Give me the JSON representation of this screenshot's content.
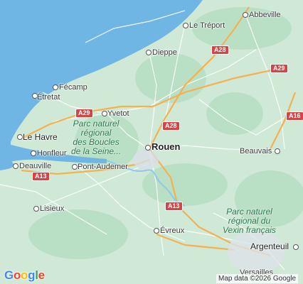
{
  "map": {
    "colors": {
      "sea": "#6fb6e4",
      "land": "#cfe9d6",
      "forest": "#b4dcc0",
      "road_major": "#f6b04e",
      "road_minor": "#ffffff",
      "shield": "#d64545"
    },
    "places": [
      {
        "name": "Abbeville",
        "id": "abbeville"
      },
      {
        "name": "Le Tréport",
        "id": "le-treport"
      },
      {
        "name": "Dieppe",
        "id": "dieppe"
      },
      {
        "name": "Fécamp",
        "id": "fecamp"
      },
      {
        "name": "Étretat",
        "id": "etretat"
      },
      {
        "name": "Yvetot",
        "id": "yvetot"
      },
      {
        "name": "Le Havre",
        "id": "le-havre"
      },
      {
        "name": "Honfleur",
        "id": "honfleur"
      },
      {
        "name": "Deauville",
        "id": "deauville"
      },
      {
        "name": "Pont-Audemer",
        "id": "pont-audemer"
      },
      {
        "name": "Rouen",
        "id": "rouen"
      },
      {
        "name": "Beauvais",
        "id": "beauvais"
      },
      {
        "name": "Lisieux",
        "id": "lisieux"
      },
      {
        "name": "Évreux",
        "id": "evreux"
      },
      {
        "name": "Argenteuil",
        "id": "argenteuil"
      },
      {
        "name": "Versailles",
        "id": "versailles"
      }
    ],
    "parks": [
      {
        "name": "Parc naturel régional des Boucles de la Seine...",
        "lines": [
          "Parc naturel",
          "régional",
          "des Boucles",
          "de la Seine..."
        ]
      },
      {
        "name": "Parc naturel régional du Vexin français",
        "lines": [
          "Parc naturel",
          "régional du",
          "Vexin français"
        ]
      }
    ],
    "road_shields": [
      "A28",
      "A29",
      "A29",
      "A28",
      "A16",
      "A13",
      "A13"
    ],
    "logo": "Google",
    "attribution": "Map data ©2026 Google"
  }
}
